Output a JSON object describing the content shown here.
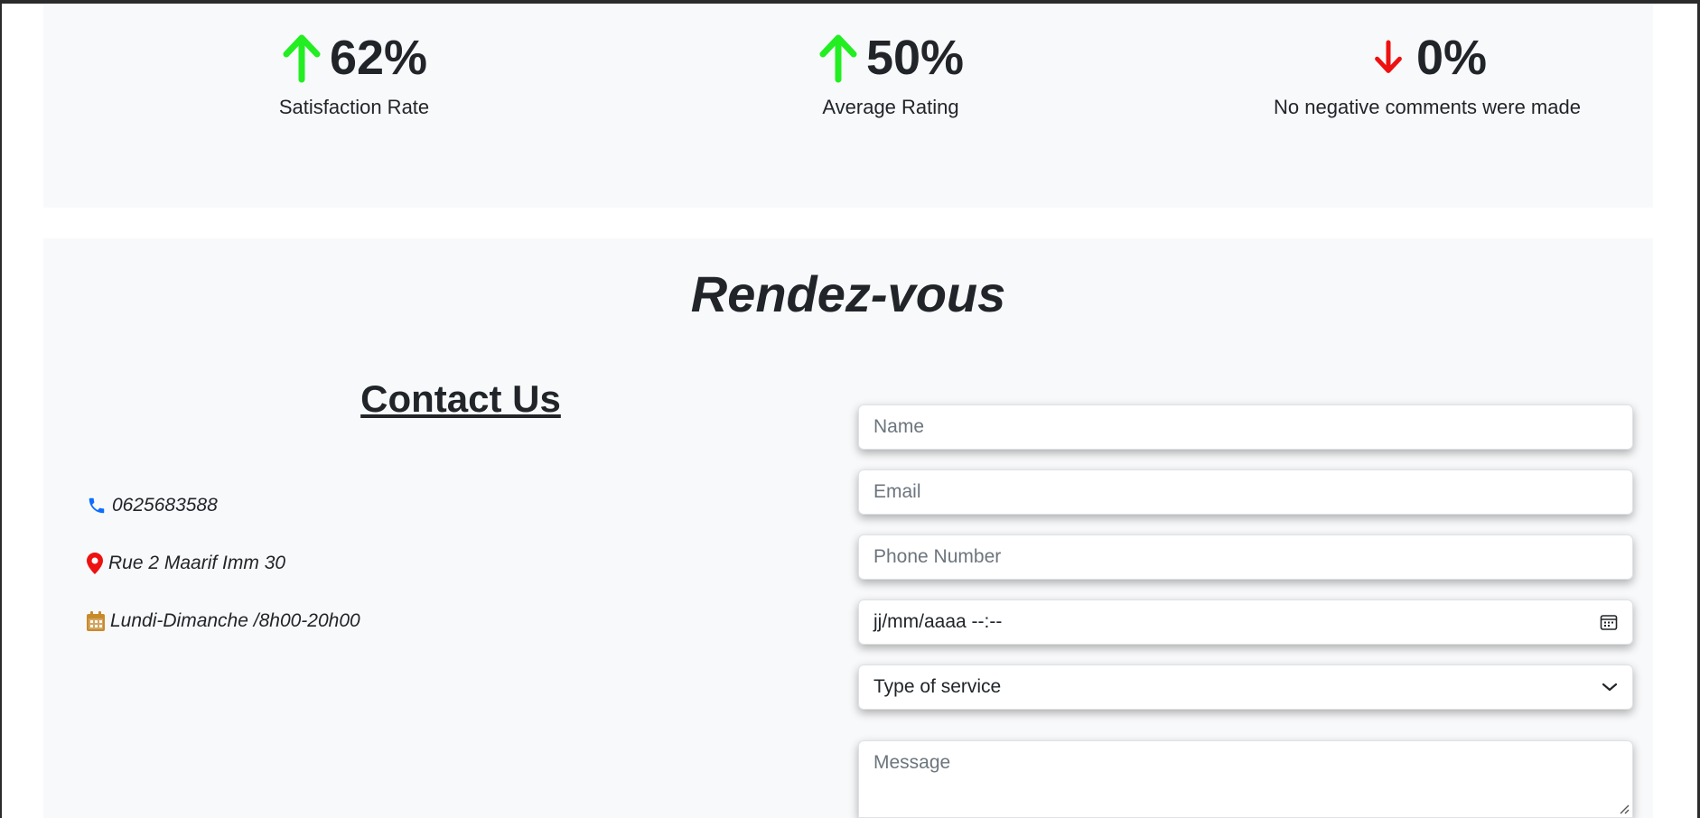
{
  "stats": [
    {
      "value": "62%",
      "label": "Satisfaction Rate",
      "trend": "up",
      "color": "#22ee22"
    },
    {
      "value": "50%",
      "label": "Average Rating",
      "trend": "up",
      "color": "#22ee22"
    },
    {
      "value": "0%",
      "label": "No negative comments were made",
      "trend": "down",
      "color": "#ee1111"
    }
  ],
  "appointment": {
    "title": "Rendez-vous",
    "contact": {
      "title": "Contact Us",
      "phone": "0625683588",
      "address": "Rue 2 Maarif Imm 30",
      "hours": "Lundi-Dimanche /8h00-20h00",
      "icons": {
        "phone": "phone-icon",
        "address": "map-pin-icon",
        "hours": "calendar-icon"
      },
      "icon_colors": {
        "phone": "#0d6efd",
        "address": "#ee1111",
        "hours": "#c98a2b"
      }
    },
    "form": {
      "name_placeholder": "Name",
      "email_placeholder": "Email",
      "phone_placeholder": "Phone Number",
      "datetime_value": "jj/mm/aaaa --:--",
      "service_value": "Type of service",
      "message_placeholder": "Message"
    }
  }
}
